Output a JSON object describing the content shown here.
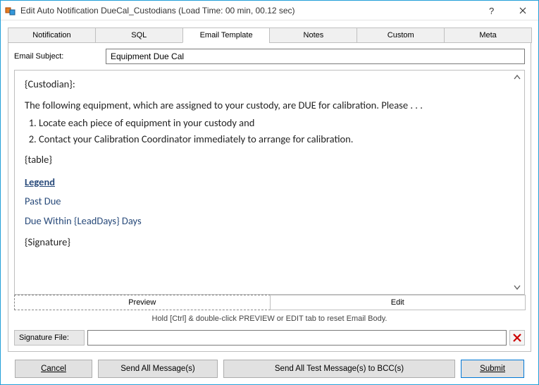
{
  "window": {
    "title": "Edit Auto Notification DueCal_Custodians (Load Time: 00 min, 00.12 sec)"
  },
  "tabs": {
    "items": [
      "Notification",
      "SQL",
      "Email Template",
      "Notes",
      "Custom",
      "Meta"
    ],
    "active": "Email Template"
  },
  "subject": {
    "label": "Email Subject:",
    "value": "Equipment Due Cal"
  },
  "body": {
    "custodian": "{Custodian}:",
    "intro": "The following equipment, which are assigned to your custody, are DUE for calibration.  Please . . .",
    "step1": "Locate each piece of equipment in your custody and",
    "step2": "Contact your Calibration Coordinator immediately to arrange for calibration.",
    "table": "{table}",
    "legend": "Legend",
    "pastdue": "Past Due",
    "duewithin": "Due Within {LeadDays} Days",
    "signature": "{Signature}"
  },
  "preview": {
    "preview": "Preview",
    "edit": "Edit"
  },
  "hint": "Hold [Ctrl] & double-click PREVIEW or EDIT tab to reset Email Body.",
  "sigfile": {
    "label": "Signature File:",
    "value": ""
  },
  "buttons": {
    "cancel": "Cancel",
    "sendall": "Send All Message(s)",
    "sendtest": "Send All Test Message(s) to BCC(s)",
    "submit": "Submit"
  }
}
